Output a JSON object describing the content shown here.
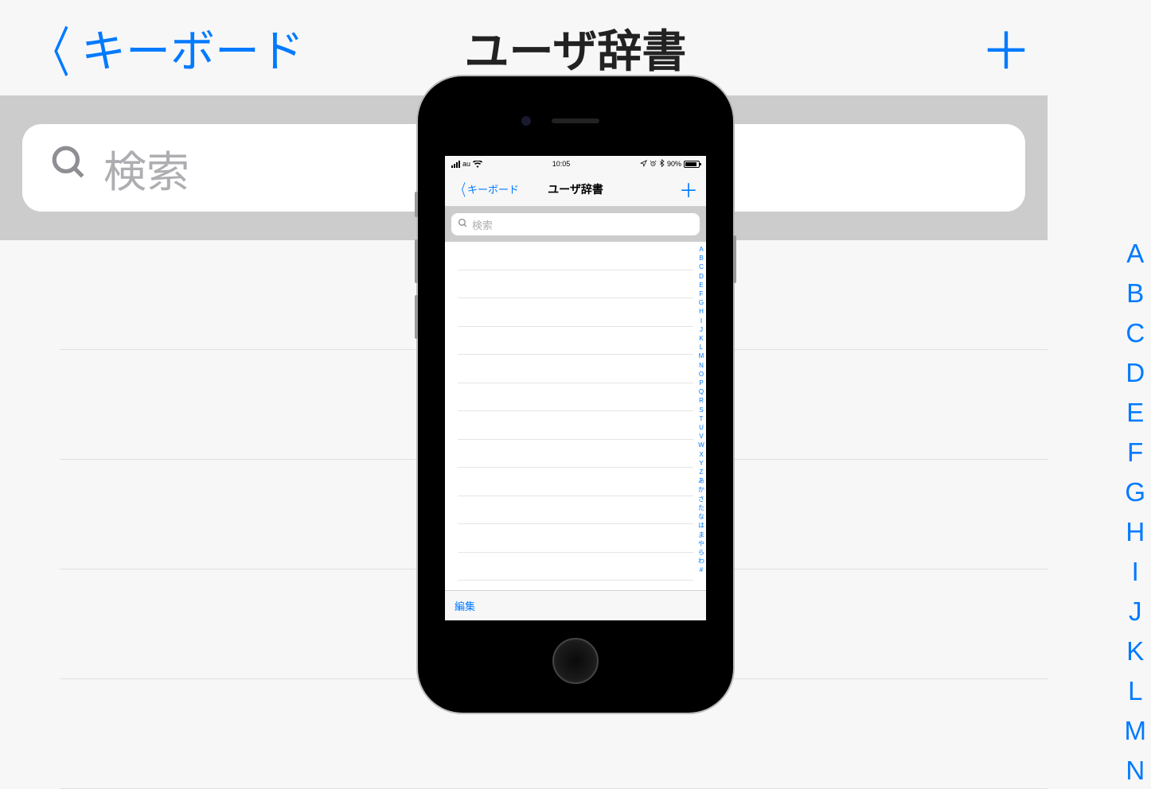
{
  "bg": {
    "back_label": "キーボード",
    "title": "ユーザ辞書",
    "search_placeholder": "検索",
    "index": [
      "A",
      "B",
      "C",
      "D",
      "E",
      "F",
      "G",
      "H",
      "I",
      "J",
      "K",
      "L",
      "M",
      "N"
    ]
  },
  "phone": {
    "status": {
      "carrier": "au",
      "time": "10:05",
      "battery_pct": "90%"
    },
    "nav": {
      "back_label": "キーボード",
      "title": "ユーザ辞書"
    },
    "search_placeholder": "検索",
    "index": [
      "A",
      "B",
      "C",
      "D",
      "E",
      "F",
      "G",
      "H",
      "I",
      "J",
      "K",
      "L",
      "M",
      "N",
      "O",
      "P",
      "Q",
      "R",
      "S",
      "T",
      "U",
      "V",
      "W",
      "X",
      "Y",
      "Z",
      "あ",
      "か",
      "さ",
      "た",
      "な",
      "は",
      "ま",
      "や",
      "ら",
      "わ",
      "#"
    ],
    "toolbar": {
      "edit_label": "編集"
    }
  }
}
